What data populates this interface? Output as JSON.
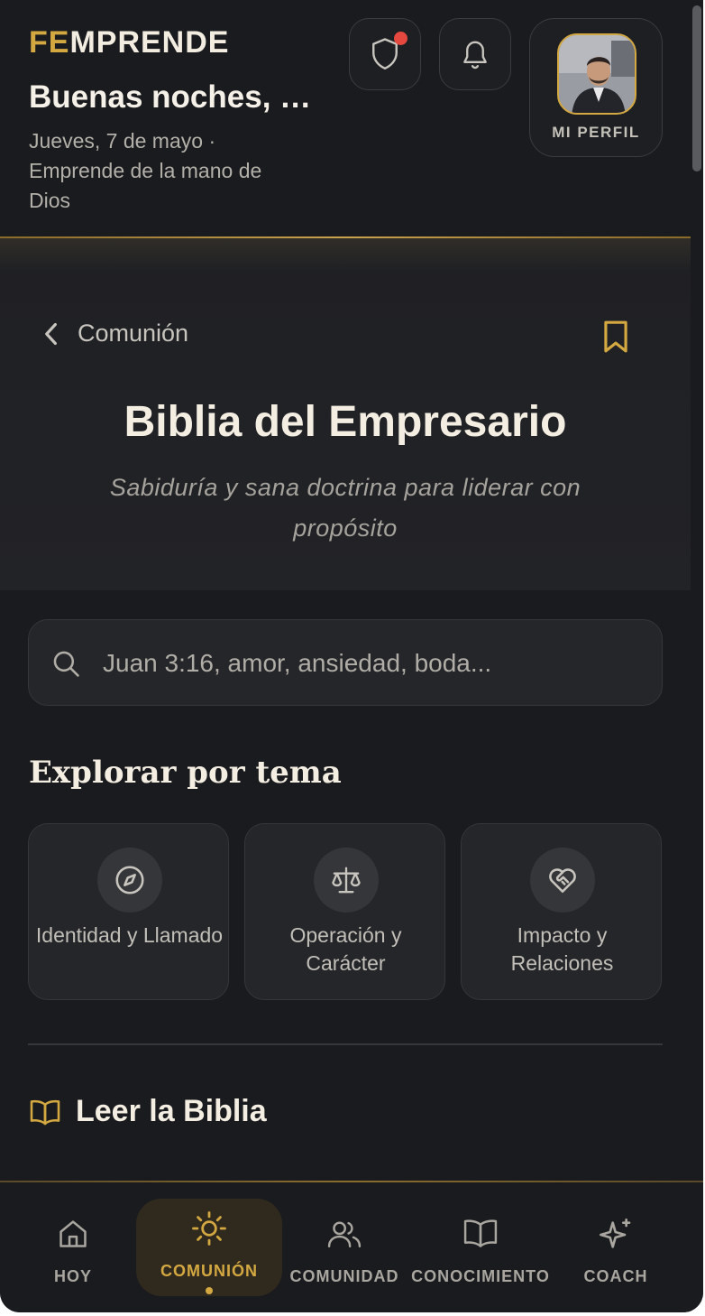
{
  "header": {
    "logo_accent": "FE",
    "logo_rest": "MPRENDE",
    "greeting": "Buenas noches, …",
    "date_line": "Jueves, 7 de mayo ·",
    "tagline": "Emprende de la mano de Dios",
    "profile_label": "MI PERFIL",
    "shield_icon": "shield-icon",
    "bell_icon": "bell-icon",
    "notification_dot_color": "#e5483e"
  },
  "hero": {
    "back_label": "Comunión",
    "title": "Biblia del Empresario",
    "subtitle": "Sabiduría y sana doctrina para liderar con propósito"
  },
  "search": {
    "placeholder": "Juan 3:16, amor, ansiedad, boda..."
  },
  "explore": {
    "title": "Explorar por tema",
    "topics": [
      {
        "label": "Identidad y Llamado",
        "icon": "compass-icon"
      },
      {
        "label": "Operación y Carácter",
        "icon": "scale-icon"
      },
      {
        "label": "Impacto y Relaciones",
        "icon": "heart-handshake-icon"
      }
    ]
  },
  "read": {
    "label": "Leer la Biblia",
    "icon": "open-book-icon"
  },
  "nav": {
    "items": [
      {
        "label": "HOY",
        "icon": "home-icon"
      },
      {
        "label": "COMUNIÓN",
        "icon": "sun-icon",
        "active": true
      },
      {
        "label": "COMUNIDAD",
        "icon": "users-icon"
      },
      {
        "label": "CONOCIMIENTO",
        "icon": "book-icon"
      },
      {
        "label": "COACH",
        "icon": "sparkles-icon"
      }
    ]
  },
  "colors": {
    "accent": "#d4a841",
    "background": "#1a1b1e",
    "card": "#25262a"
  }
}
